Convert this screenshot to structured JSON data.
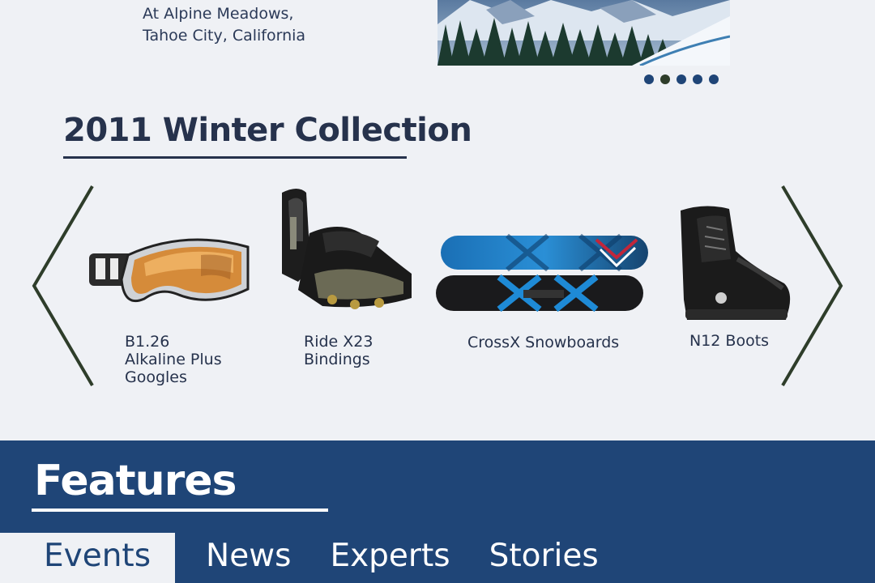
{
  "location": {
    "line1": "At Alpine Meadows,",
    "line2": "Tahoe City, California"
  },
  "carousel": {
    "dot_count": 5,
    "active_index": 1
  },
  "collection": {
    "title": "2011 Winter Collection",
    "prev_icon": "chevron-left-icon",
    "next_icon": "chevron-right-icon",
    "products": [
      {
        "lines": [
          "B1.26",
          "Alkaline Plus",
          "Googles"
        ],
        "icon": "goggles-image"
      },
      {
        "lines": [
          "Ride X23",
          "Bindings"
        ],
        "icon": "bindings-image"
      },
      {
        "lines": [
          "CrossX Snowboards"
        ],
        "icon": "snowboards-image"
      },
      {
        "lines": [
          "N12 Boots"
        ],
        "icon": "boots-image"
      }
    ]
  },
  "features": {
    "title": "Features",
    "tabs": [
      "Events",
      "News",
      "Experts",
      "Stories"
    ],
    "active_tab": "Events"
  },
  "colors": {
    "background": "#eff1f5",
    "brand_blue": "#1f4577",
    "heading_navy": "#26324c",
    "arrow_green": "#2e3d2a"
  }
}
